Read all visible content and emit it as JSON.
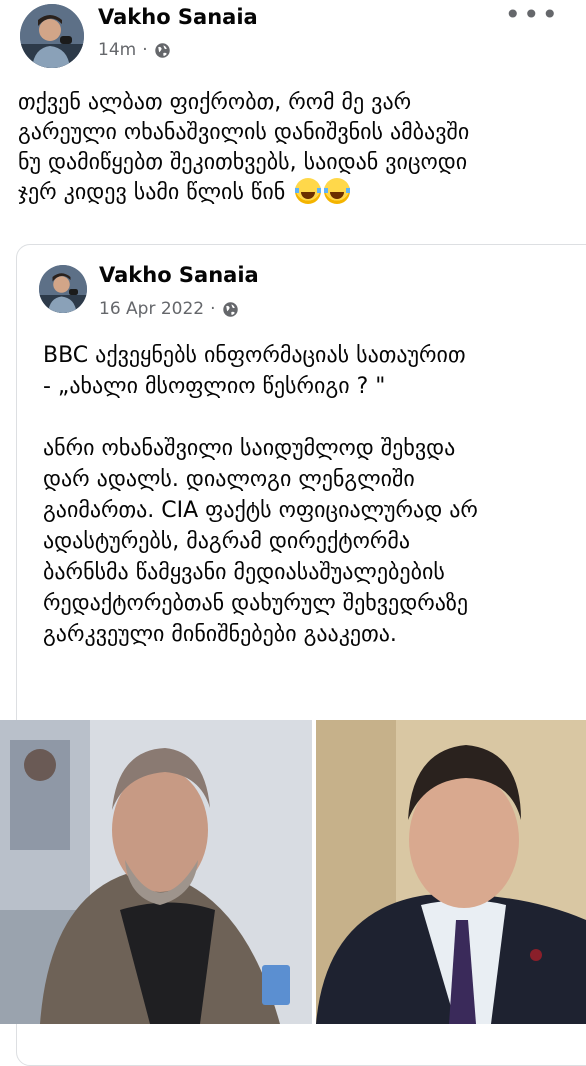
{
  "post": {
    "author": "Vakho Sanaia",
    "time": "14m",
    "privacy_icon": "globe-icon",
    "more_label": "•••",
    "lines": [
      "თქვენ ალბათ ფიქრობთ, რომ მე ვარ",
      "გარეული ოხანაშვილის დანიშვნის ამბავში",
      "ნუ დამიწყებთ შეკითხვებს, საიდან ვიცოდი",
      "ჯერ კიდევ სამი წლის წინ"
    ],
    "emojis": [
      "laughing-emoji",
      "laughing-emoji"
    ]
  },
  "shared_post": {
    "author": "Vakho Sanaia",
    "date": "16 Apr 2022",
    "privacy_icon": "globe-icon",
    "lines": [
      "BBC აქვეყნებს ინფორმაციას სათაურით",
      "- „ახალი მსოფლიო წესრიგი ? \"",
      "",
      "ანრი ოხანაშვილი  საიდუმლოდ შეხვდა",
      "დარ ადალს. დიალოგი ლენგლიში",
      "გაიმართა. CIA ფაქტს ოფიციალურად არ",
      "ადასტურებს, მაგრამ დირექტორმა",
      "ბარნსმა წამყვანი მედიასაშუალებების",
      "რედაქტორებთან დახურულ შეხვედრაზე",
      "გარკვეული მინიშნებები გააკეთა."
    ]
  }
}
